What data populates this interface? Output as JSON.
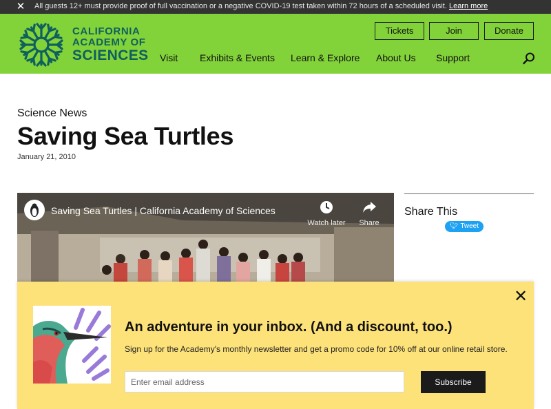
{
  "alert": {
    "message": "All guests 12+ must provide proof of full vaccination or a negative COVID-19 test taken within 72 hours of a scheduled visit.",
    "link": "Learn more"
  },
  "logo": {
    "line1": "CALIFORNIA",
    "line2": "ACADEMY OF",
    "line3": "SCIENCES",
    "color": "#0f5f5f"
  },
  "header": {
    "bg_color": "#82d23a",
    "buttons": {
      "tickets": "Tickets",
      "join": "Join",
      "donate": "Donate"
    },
    "nav": [
      "Visit",
      "Exhibits & Events",
      "Learn & Explore",
      "About Us",
      "Support"
    ],
    "search_icon": "search-icon"
  },
  "article": {
    "kicker": "Science News",
    "title": "Saving Sea Turtles",
    "date": "January 21, 2010"
  },
  "video": {
    "title": "Saving Sea Turtles | California Academy of Sciences",
    "watch_later": "Watch later",
    "share": "Share"
  },
  "share": {
    "title": "Share This",
    "tweet": "Tweet",
    "tweet_color": "#1da1f2"
  },
  "newsletter": {
    "bg_color": "#fde27a",
    "heading": "An adventure in your inbox. (And a discount, too.)",
    "subtext": "Sign up for the Academy's monthly newsletter and get a promo code for 10% off at our online retail store.",
    "email_placeholder": "Enter email address",
    "subscribe": "Subscribe"
  }
}
